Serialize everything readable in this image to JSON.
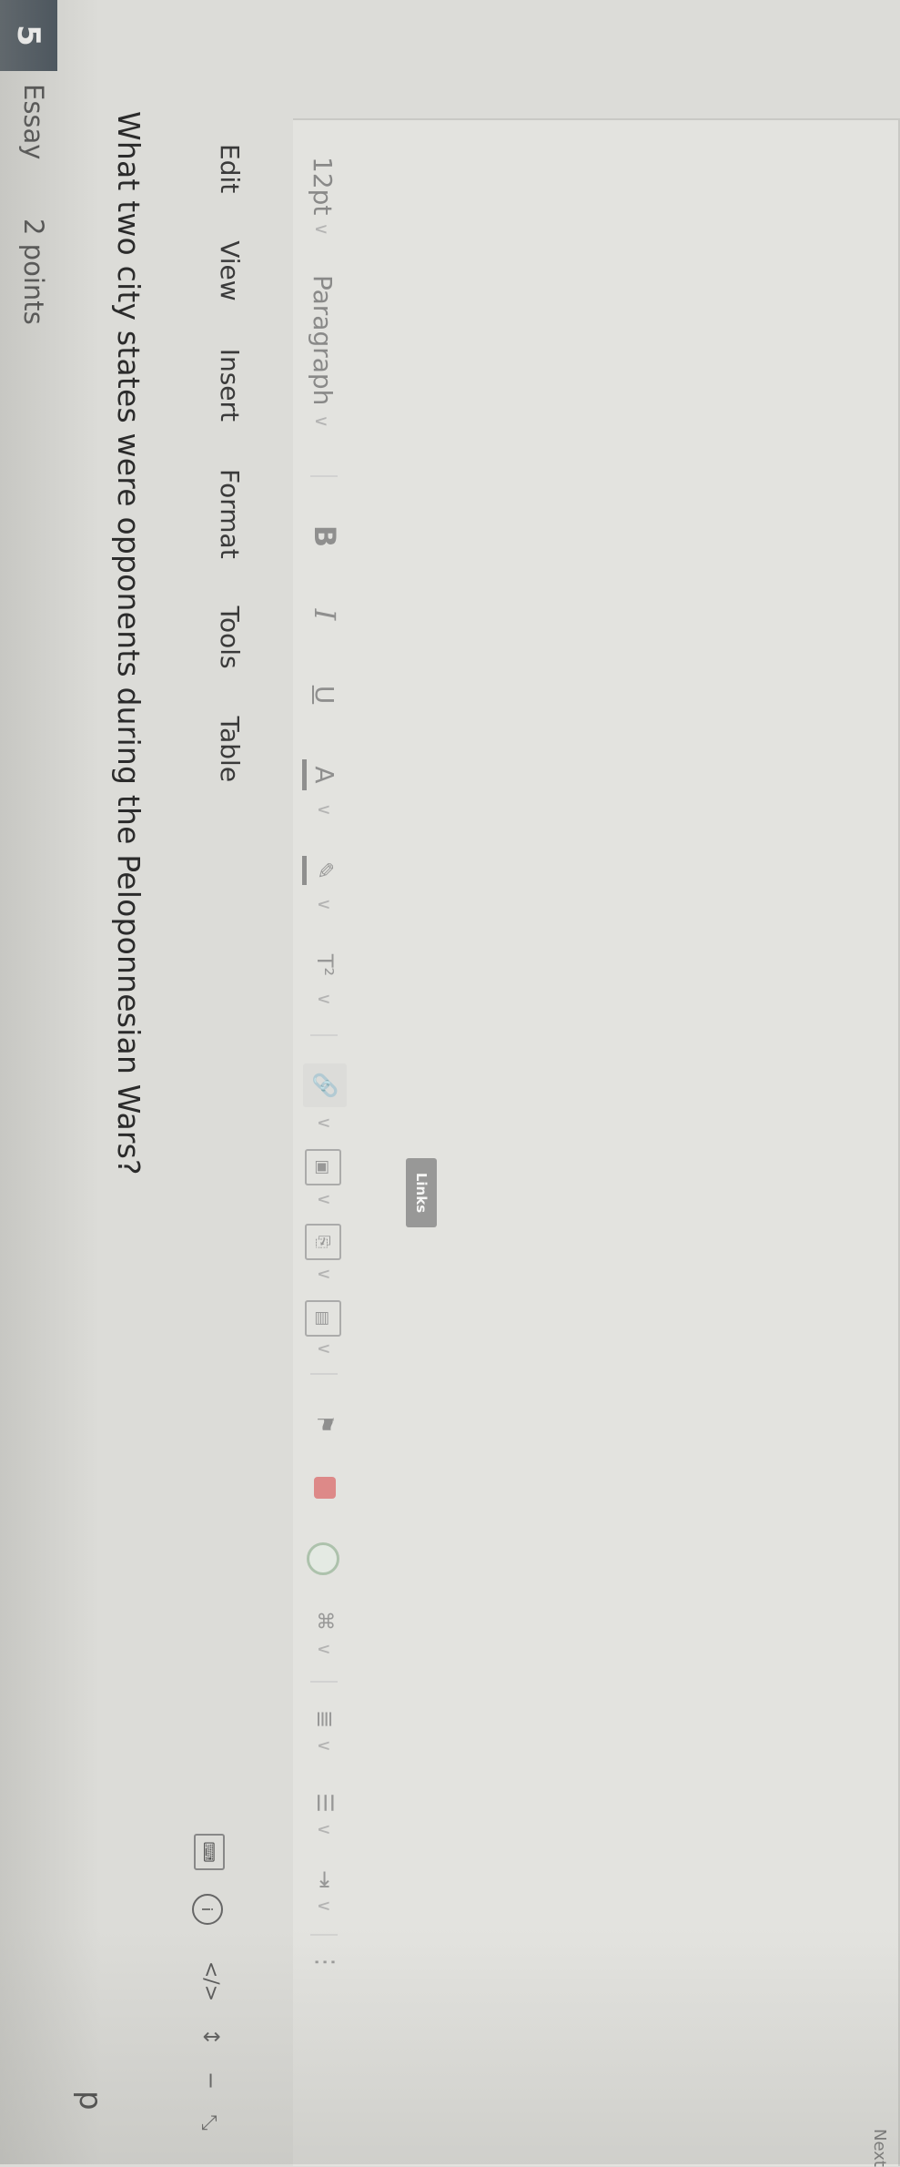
{
  "question": {
    "number": "5",
    "type": "Essay",
    "points": "2 points",
    "prompt": "What two city states were opponents during the Peloponnesian Wars?"
  },
  "editor": {
    "menu": [
      "Edit",
      "View",
      "Insert",
      "Format",
      "Tools",
      "Table"
    ],
    "toolbar": {
      "font_size": "12pt",
      "block_format": "Paragraph",
      "bold": "B",
      "italic": "I",
      "underline": "U",
      "text_color": "A",
      "superscript": "T²",
      "tooltip": "Links"
    },
    "icons": [
      "chevron-down-icon",
      "bold-icon",
      "italic-icon",
      "underline-icon",
      "text-color-icon",
      "highlight-icon",
      "superscript-icon",
      "link-icon",
      "image-icon",
      "document-icon",
      "media-icon",
      "bookmark-icon",
      "record-icon",
      "circle-icon",
      "apps-icon",
      "align-icon",
      "list-icon",
      "indent-icon",
      "more-icon"
    ],
    "status": {
      "path": "p"
    },
    "footer": {
      "next": "Next"
    }
  }
}
